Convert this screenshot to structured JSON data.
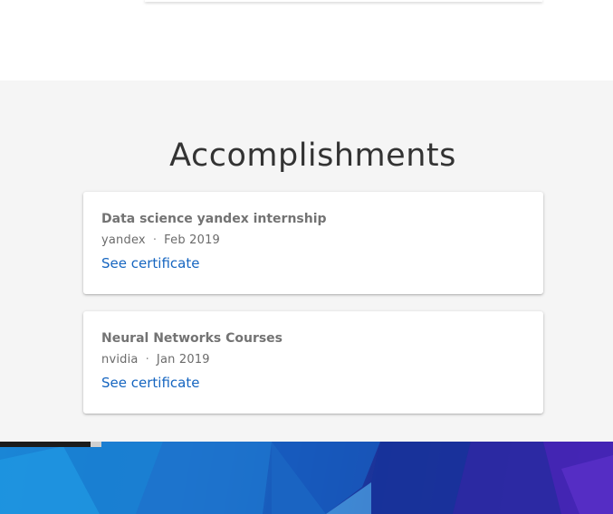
{
  "section": {
    "title": "Accomplishments"
  },
  "accomplishments": [
    {
      "title": "Data science yandex internship",
      "issuer": "yandex",
      "separator": "·",
      "date": "Feb 2019",
      "link_label": "See certificate"
    },
    {
      "title": "Neural Networks Courses",
      "issuer": "nvidia",
      "separator": "·",
      "date": "Jan 2019",
      "link_label": "See certificate"
    }
  ],
  "colors": {
    "section_background": "#f5f5f5",
    "link": "#1565c0",
    "title_text": "#333333",
    "card_title": "#737373"
  }
}
